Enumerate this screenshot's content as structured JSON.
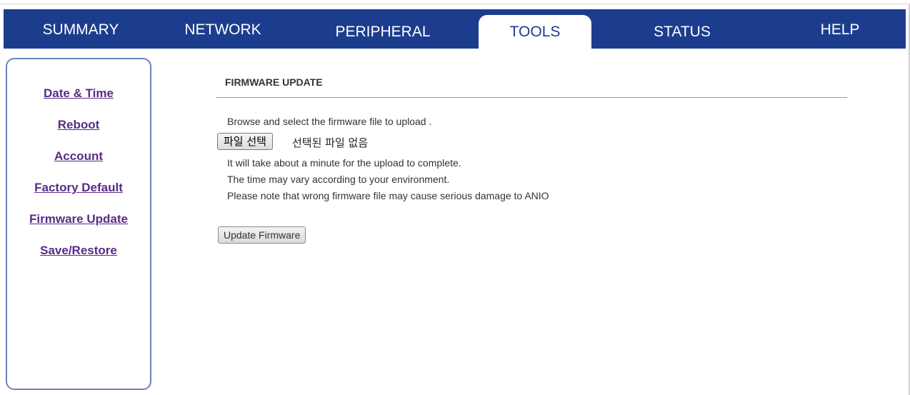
{
  "nav": {
    "tabs": [
      {
        "label": "SUMMARY",
        "active": false
      },
      {
        "label": "NETWORK",
        "active": false
      },
      {
        "label": "PERIPHERAL",
        "active": false
      },
      {
        "label": "TOOLS",
        "active": true
      },
      {
        "label": "STATUS",
        "active": false
      },
      {
        "label": "HELP",
        "active": false
      }
    ]
  },
  "sidebar": {
    "items": [
      {
        "label": "Date & Time"
      },
      {
        "label": "Reboot"
      },
      {
        "label": "Account"
      },
      {
        "label": "Factory Default"
      },
      {
        "label": "Firmware Update"
      },
      {
        "label": "Save/Restore"
      }
    ]
  },
  "main": {
    "title": "FIRMWARE UPDATE",
    "instruction": "Browse and select the firmware file to upload .",
    "file_button_label": "파일 선택",
    "file_status": "선택된 파일 없음",
    "notes": [
      "It will take about a minute for the upload to complete.",
      "The time may vary according to your environment.",
      "Please note that wrong firmware file may cause serious damage to ANIO"
    ],
    "update_button_label": "Update Firmware"
  },
  "colors": {
    "nav_background": "#1c3d8e",
    "link_color": "#5a2a86",
    "sidebar_border": "#6b82b8"
  }
}
